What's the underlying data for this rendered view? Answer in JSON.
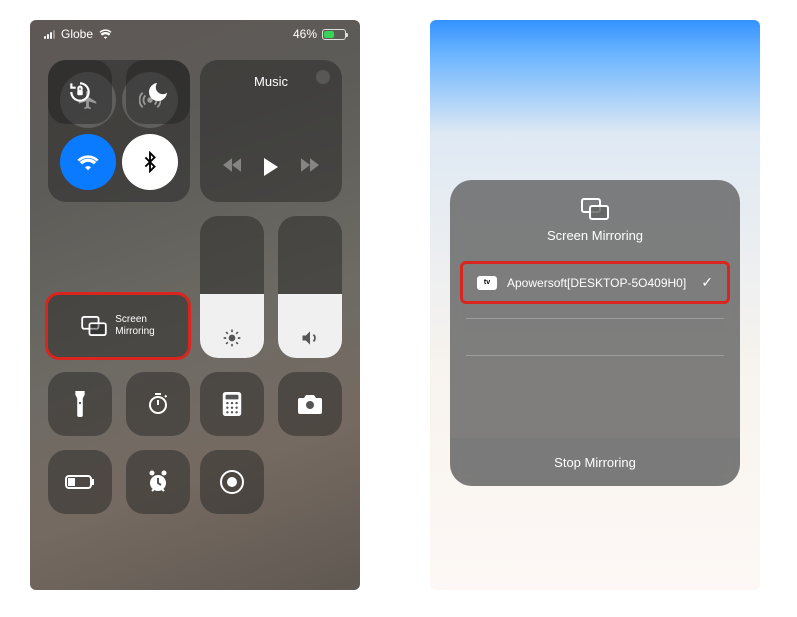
{
  "left": {
    "statusbar": {
      "carrier": "Globe",
      "battery_label": "46%",
      "battery_fill_percent": 46,
      "battery_color": "#36d357"
    },
    "connectivity": {
      "airplane": true,
      "cellular": true,
      "wifi": true,
      "bluetooth": true
    },
    "music": {
      "label": "Music"
    },
    "screen_mirroring": {
      "line1": "Screen",
      "line2": "Mirroring"
    },
    "sliders": {
      "brightness_percent": 45,
      "volume_percent": 45
    }
  },
  "right": {
    "sheet_title": "Screen Mirroring",
    "device": {
      "badge": "tv",
      "name": "Apowersoft[DESKTOP-5O409H0]",
      "selected": true
    },
    "stop_label": "Stop Mirroring"
  }
}
